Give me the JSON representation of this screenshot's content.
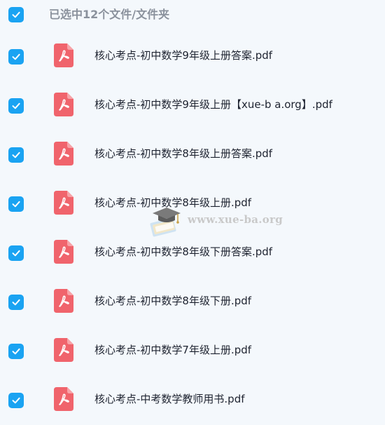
{
  "header": {
    "selection_label": "已选中12个文件/文件夹",
    "select_all_checked": true
  },
  "files": [
    {
      "name": "核心考点-初中数学9年级上册答案.pdf",
      "checked": true,
      "icon": "pdf-icon"
    },
    {
      "name": "核心考点-初中数学9年级上册【xue-b a.org】.pdf",
      "checked": true,
      "icon": "pdf-icon"
    },
    {
      "name": "核心考点-初中数学8年级上册答案.pdf",
      "checked": true,
      "icon": "pdf-icon"
    },
    {
      "name": "核心考点-初中数学8年级上册.pdf",
      "checked": true,
      "icon": "pdf-icon"
    },
    {
      "name": "核心考点-初中数学8年级下册答案.pdf",
      "checked": true,
      "icon": "pdf-icon"
    },
    {
      "name": "核心考点-初中数学8年级下册.pdf",
      "checked": true,
      "icon": "pdf-icon"
    },
    {
      "name": "核心考点-初中数学7年级上册.pdf",
      "checked": true,
      "icon": "pdf-icon"
    },
    {
      "name": "核心考点-中考数学教师用书.pdf",
      "checked": true,
      "icon": "pdf-icon"
    }
  ],
  "watermark": {
    "text": "www.xue-ba.org"
  },
  "colors": {
    "checkbox": "#1aa3f2",
    "pdf_icon": "#f0646c",
    "background": "#f4f8fc",
    "text": "#1e2330",
    "header_text": "#8a919c"
  }
}
